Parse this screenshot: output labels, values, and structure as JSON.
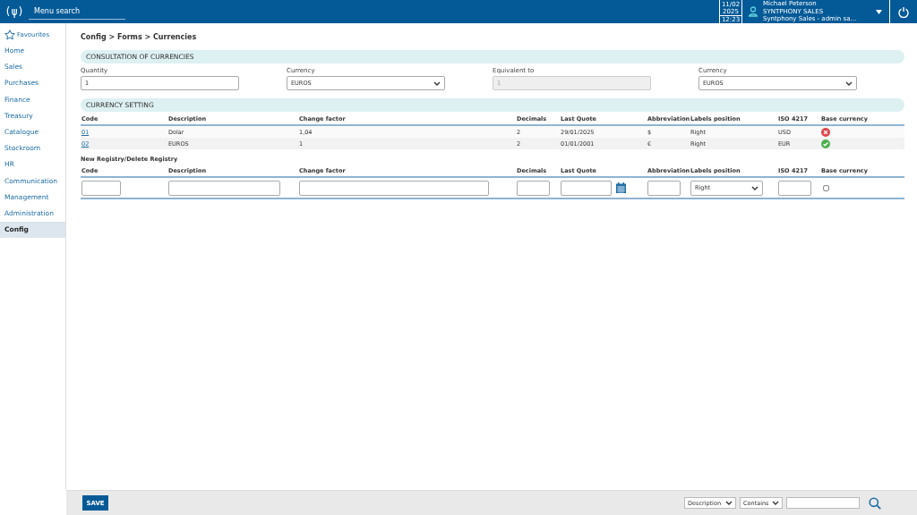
{
  "header": {
    "logo": "(ψ)",
    "menu_search": {
      "placeholder": "Menu search"
    },
    "date": {
      "day": "11/02",
      "year": "2025",
      "time": "12:23"
    },
    "user": {
      "name": "Michael Peterson",
      "company": "SYNTPHONY SALES",
      "role": "Syntphony Sales - admin sa..."
    }
  },
  "sidebar": {
    "favourites": "Favourites",
    "items": [
      {
        "label": "Home",
        "selected": false
      },
      {
        "label": "Sales",
        "selected": false
      },
      {
        "label": "Purchases",
        "selected": false
      },
      {
        "label": "Finance",
        "selected": false
      },
      {
        "label": "Treasury",
        "selected": false
      },
      {
        "label": "Catalogue",
        "selected": false
      },
      {
        "label": "Stockroom",
        "selected": false
      },
      {
        "label": "HR",
        "selected": false
      },
      {
        "label": "Communication",
        "selected": false
      },
      {
        "label": "Management",
        "selected": false
      },
      {
        "label": "Administration",
        "selected": false
      },
      {
        "label": "Config",
        "selected": true
      }
    ]
  },
  "breadcrumb": "Config > Forms > Currencies",
  "consultation": {
    "title": "CONSULTATION OF CURRENCIES",
    "fields": [
      {
        "kind": "input",
        "label": "Quantity",
        "value": "1"
      },
      {
        "kind": "select",
        "label": "Currency",
        "value": "EUROS"
      },
      {
        "kind": "readonly",
        "label": "Equivalent to",
        "value": "1"
      },
      {
        "kind": "select",
        "label": "Currency",
        "value": "EUROS"
      }
    ]
  },
  "currency_setting": {
    "title": "CURRENCY SETTING",
    "columns": [
      "Code",
      "Description",
      "Change factor",
      "Decimals",
      "Last Quote",
      "Abbreviation",
      "Labels position",
      "ISO 4217",
      "Base currency"
    ],
    "rows": [
      {
        "code": "01",
        "description": "Dolar",
        "change_factor": "1,04",
        "decimals": "2",
        "last_quote": "29/01/2025",
        "abbreviation": "$",
        "labels_position": "Right",
        "iso": "USD",
        "base": false
      },
      {
        "code": "02",
        "description": "EUROS",
        "change_factor": "1",
        "decimals": "2",
        "last_quote": "01/01/2001",
        "abbreviation": "€",
        "labels_position": "Right",
        "iso": "EUR",
        "base": true
      }
    ]
  },
  "new_registry": {
    "title": "New Registry/Delete Registry",
    "columns": [
      "Code",
      "Description",
      "Change factor",
      "Decimals",
      "Last Quote",
      "Abbreviation",
      "Labels position",
      "ISO 4217",
      "Base currency"
    ],
    "labels_position": "Right",
    "base_checked": false
  },
  "footer": {
    "save": "SAVE",
    "filter_field": "Description",
    "filter_op": "Contains"
  }
}
